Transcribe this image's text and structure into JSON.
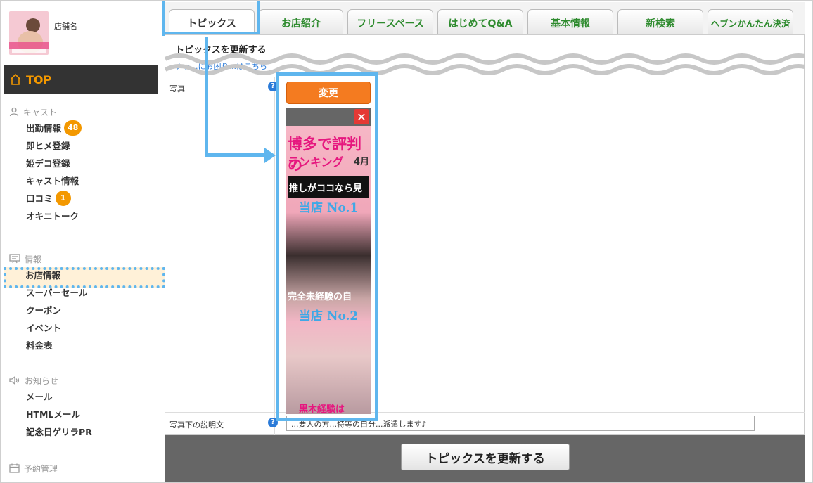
{
  "sidebar": {
    "shop_name": "店舗名",
    "top_label": "TOP",
    "cast": {
      "heading": "キャスト",
      "items": [
        {
          "label": "出勤情報",
          "badge": "48"
        },
        {
          "label": "即ヒメ登録"
        },
        {
          "label": "姫デコ登録"
        },
        {
          "label": "キャスト情報"
        },
        {
          "label": "口コミ",
          "badge": "1"
        },
        {
          "label": "オキニトーク"
        }
      ]
    },
    "info": {
      "heading": "情報",
      "items": [
        {
          "label": "お店情報"
        },
        {
          "label": "スーパーセール"
        },
        {
          "label": "クーポン"
        },
        {
          "label": "イベント"
        },
        {
          "label": "料金表"
        }
      ]
    },
    "notice": {
      "heading": "お知らせ",
      "items": [
        {
          "label": "メール"
        },
        {
          "label": "HTMLメール"
        },
        {
          "label": "記念日ゲリラPR"
        }
      ]
    },
    "reservation": {
      "heading": "予約管理"
    }
  },
  "tabs": [
    {
      "label": "トピックス",
      "active": true
    },
    {
      "label": "お店紹介"
    },
    {
      "label": "フリースペース"
    },
    {
      "label": "はじめてQ&A"
    },
    {
      "label": "基本情報"
    },
    {
      "label": "新検索"
    },
    {
      "label": "ヘブンかんたん決済"
    }
  ],
  "content": {
    "title": "トピックスを更新する",
    "help_link": "ナッ...にお困り...はこちら",
    "photo_label": "写真",
    "change_button": "変更",
    "close_symbol": "✕",
    "banner_texts": {
      "line1": "博多で評判の",
      "line2": "ランキング",
      "month": "4月",
      "catch": "推しがココなら見",
      "rank1": "当店 No.1",
      "tag": "完全未経験の自",
      "rank2": "当店 No.2",
      "bottom": "黒木経験は"
    },
    "desc_label": "写真下の説明文",
    "desc_value": "...要人の方...特等の自分...派遣します♪",
    "qmark": "?",
    "submit_button": "トピックスを更新する"
  },
  "colors": {
    "accent_orange": "#f39800",
    "highlight_blue": "#5fb6ee",
    "tab_text_green": "#2e8b2e"
  }
}
